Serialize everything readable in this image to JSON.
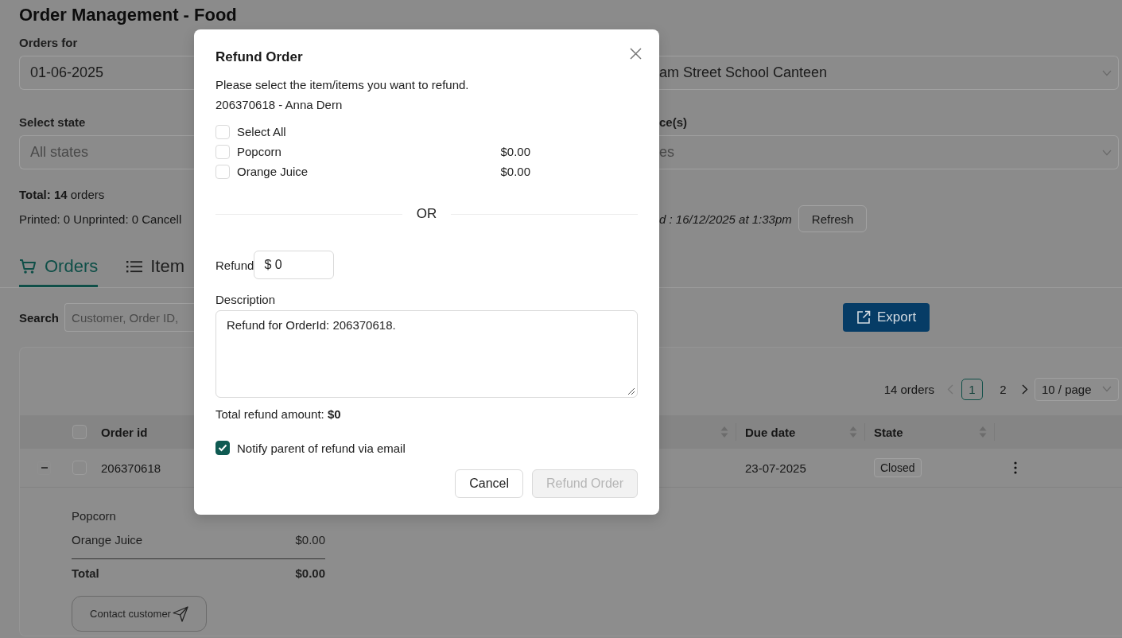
{
  "page": {
    "title": "Order Management - Food",
    "filters": [
      {
        "label": "Orders for",
        "value": "01-06-2025"
      },
      {
        "label": "Select state",
        "placeholder": "All states"
      }
    ],
    "right_filters": [
      {
        "value": "am Street School Canteen"
      },
      {
        "label": "ce(s)",
        "placeholder": "es"
      }
    ],
    "summary": {
      "total": "**Total: 14** orders",
      "counts": "Printed: 0 Unprinted: 0 Cancell",
      "updated": "d : 16/12/2025 at 1:33pm",
      "refresh_button": "Refresh"
    },
    "tabs": [
      {
        "label": "Orders",
        "selected": true
      },
      {
        "label": "Item",
        "selected": false
      }
    ],
    "search": {
      "label": "Search",
      "placeholder": "Customer, Order ID,"
    },
    "export_button": "Export",
    "pagination": {
      "total": "14 orders",
      "pages": [
        {
          "label": "1",
          "selected": true
        },
        {
          "label": "2",
          "selected": false
        }
      ],
      "page_size": "10 / page"
    },
    "table": {
      "header_checked": false,
      "columns": [
        "Order id",
        "Due date",
        "State"
      ],
      "rows": [
        {
          "order_id": "206370618",
          "due_date": "23-07-2025",
          "state": "Closed",
          "checked": false,
          "expanded": true,
          "items": [
            {
              "name": "Popcorn"
            },
            {
              "name": "Orange Juice",
              "price": "$0.00"
            }
          ],
          "total_label": "Total",
          "total": "$0.00",
          "contact_button": "Contact customer"
        }
      ]
    }
  },
  "dialog": {
    "title": "Refund Order",
    "instruction": "Please select the item/items you want to refund.",
    "order_line": "206370618 - Anna Dern",
    "select_all": {
      "label": "Select All",
      "checked": false
    },
    "items": [
      {
        "name": "Popcorn",
        "price": "$0.00",
        "checked": false
      },
      {
        "name": "Orange Juice",
        "price": "$0.00",
        "checked": false
      }
    ],
    "divider_text": "OR",
    "refund": {
      "label": "Refund",
      "value": "$ 0"
    },
    "description": {
      "label": "Description",
      "value": "Refund for OrderId: 206370618."
    },
    "total_refund": "Total refund amount: **$0**",
    "notify": {
      "label": "Notify parent of refund via email",
      "checked": true
    },
    "buttons": [
      {
        "label": "Cancel",
        "disabled": false
      },
      {
        "label": "Refund Order",
        "disabled": true
      }
    ]
  }
}
